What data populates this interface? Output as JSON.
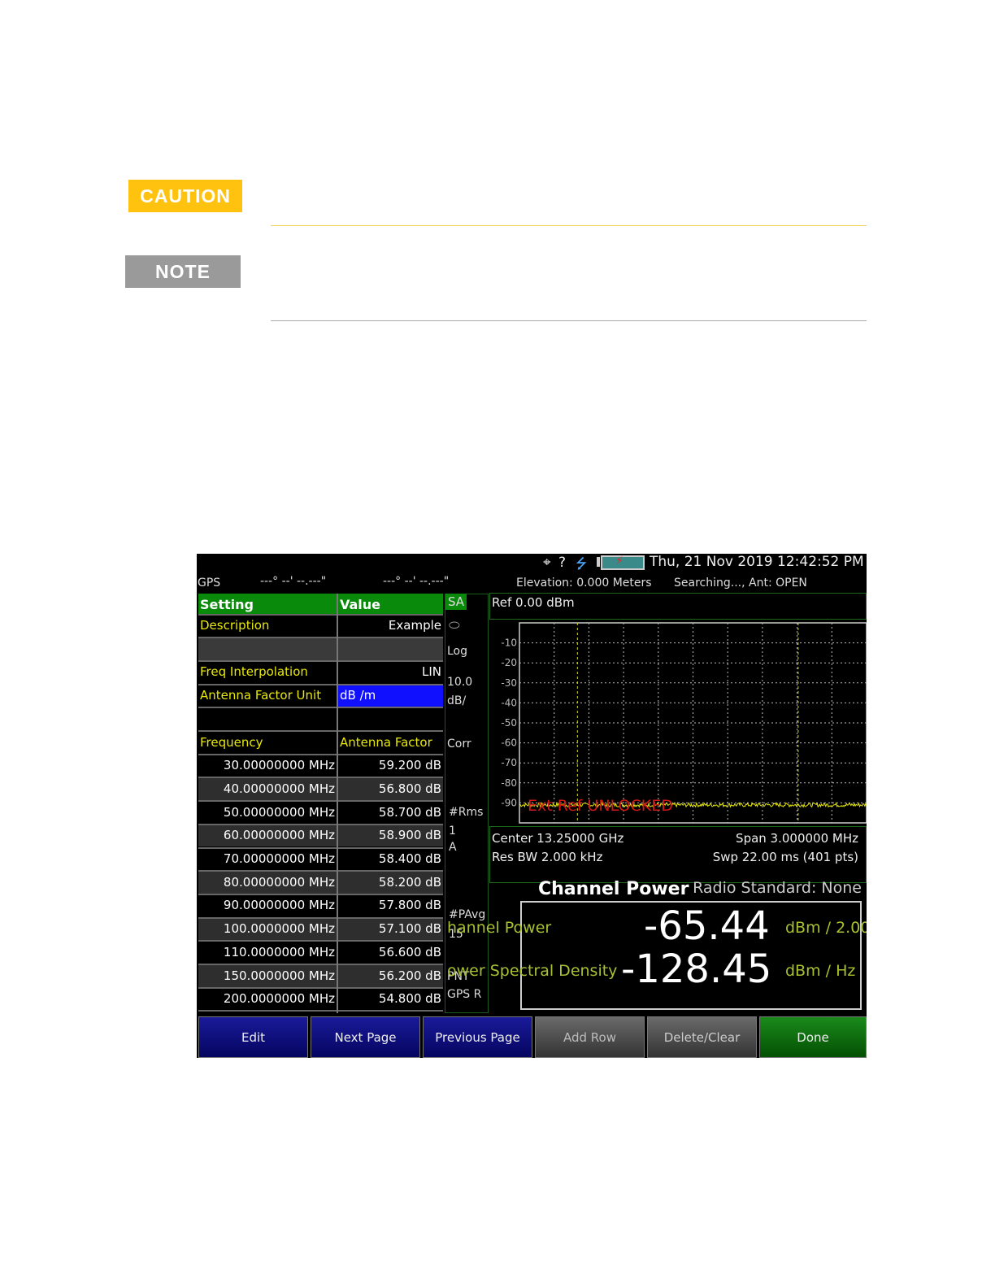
{
  "doc": {
    "caution_label": "CAUTION",
    "note_label": "NOTE",
    "colors": {
      "caution": "#FFC20E",
      "note": "#9a9a9a"
    }
  },
  "screen": {
    "status": {
      "icons": [
        "gps-crosshair-icon",
        "usb-icon",
        "battery-icon"
      ],
      "gps_query": "?",
      "datetime": "Thu, 21 Nov 2019 12:42:52 PM"
    },
    "gps": {
      "label": "GPS",
      "lat": "---° --' --.---\"",
      "lon": "---° --' --.---\"",
      "elevation": "Elevation: 0.000 Meters",
      "search": "Searching..., Ant: OPEN"
    },
    "table": {
      "headers": [
        "Setting",
        "Value"
      ],
      "settings": [
        {
          "name": "Description",
          "value": "Example"
        },
        {
          "name": "",
          "value": ""
        },
        {
          "name": "Freq Interpolation",
          "value": "LIN"
        },
        {
          "name": "Antenna Factor Unit",
          "value": "dB /m"
        },
        {
          "name": "",
          "value": ""
        }
      ],
      "data_headers": [
        "Frequency",
        "Antenna Factor"
      ],
      "rows": [
        [
          "30.00000000 MHz",
          "59.200 dB"
        ],
        [
          "40.00000000 MHz",
          "56.800 dB"
        ],
        [
          "50.00000000 MHz",
          "58.700 dB"
        ],
        [
          "60.00000000 MHz",
          "58.900 dB"
        ],
        [
          "70.00000000 MHz",
          "58.400 dB"
        ],
        [
          "80.00000000 MHz",
          "58.200 dB"
        ],
        [
          "90.00000000 MHz",
          "57.800 dB"
        ],
        [
          "100.0000000 MHz",
          "57.100 dB"
        ],
        [
          "110.0000000 MHz",
          "56.600 dB"
        ],
        [
          "150.0000000 MHz",
          "56.200 dB"
        ],
        [
          "200.0000000 MHz",
          "54.800 dB"
        ]
      ]
    },
    "side": {
      "mode": "SA",
      "scale": "Log",
      "div1": "10.0",
      "div2": "dB/",
      "corr": "Corr",
      "det": "#Rms",
      "trace": "1",
      "trace_type": "A",
      "pavg": "#PAvg",
      "pavg_n": "15",
      "pnt": "PNT",
      "gps_r": "GPS R"
    },
    "spectrum": {
      "ref": "Ref 0.00 dBm",
      "y_ticks": [
        "-10",
        "-20",
        "-30",
        "-40",
        "-50",
        "-60",
        "-70",
        "-80",
        "-90"
      ],
      "warning": "Ext Ref UNLOCKED",
      "trace_level_dbm": -91,
      "trace_color": "#e8e80a"
    },
    "info": {
      "center": "Center 13.25000 GHz",
      "span": "Span 3.000000 MHz",
      "rbw": "Res BW 2.000 kHz",
      "swp": "Swp 22.00 ms (401 pts)"
    },
    "result": {
      "title": "Channel Power",
      "standard": "Radio Standard: None",
      "cp_label": "hannel Power",
      "cp_value": "-65.44",
      "cp_unit": "dBm / 2.00",
      "psd_label": "ower Spectral Density",
      "psd_value": "-128.45",
      "psd_unit": "dBm / Hz"
    },
    "buttons": [
      "Edit",
      "Next Page",
      "Previous Page",
      "Add Row",
      "Delete/Clear",
      "Done"
    ]
  }
}
